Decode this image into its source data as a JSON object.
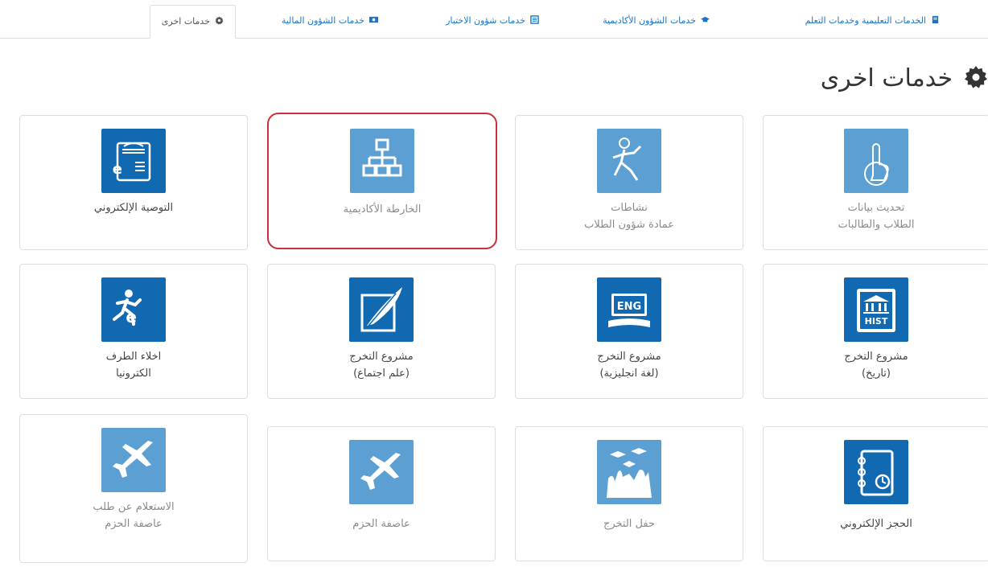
{
  "tabs": [
    {
      "label": "الخدمات التعليمية وخدمات التعلم",
      "icon": "book-icon"
    },
    {
      "label": "خدمات الشؤون الأكاديمية",
      "icon": "graduation-cap-icon"
    },
    {
      "label": "خدمات شؤون الاختبار",
      "icon": "list-icon"
    },
    {
      "label": "خدمات الشؤون المالية",
      "icon": "money-icon"
    },
    {
      "label": "خدمات اخرى",
      "icon": "gear-icon",
      "active": true
    }
  ],
  "page": {
    "title": "خدمات اخرى",
    "icon": "gear-icon"
  },
  "colors": {
    "tile_dark": "#1169b2",
    "tile_light": "#5c9fd3",
    "highlight": "#c9303c",
    "link": "#1a73c9"
  },
  "cards": [
    {
      "id": "update-data",
      "icon": "hand-tap-icon",
      "lines": [
        "تحديث بيانات",
        "الطلاب والطالبات"
      ],
      "faded": true
    },
    {
      "id": "activities",
      "icon": "dancer-icon",
      "lines": [
        "نشاطات",
        "عمادة شؤون الطلاب"
      ],
      "faded": true
    },
    {
      "id": "academic-map",
      "icon": "sitemap-icon",
      "lines": [
        "الخارطة الأكاديمية"
      ],
      "faded": true,
      "highlighted": true
    },
    {
      "id": "e-recommendation",
      "icon": "e-document-icon",
      "lines": [
        "التوصية الإلكتروني"
      ],
      "faded": false
    },
    {
      "id": "grad-history",
      "icon": "hist-book-icon",
      "lines": [
        "مشروع التخرج",
        "(تاريخ)"
      ],
      "faded": false
    },
    {
      "id": "grad-english",
      "icon": "eng-book-icon",
      "lines": [
        "مشروع التخرج",
        "(لغة انجليزية)"
      ],
      "faded": false
    },
    {
      "id": "grad-sociology",
      "icon": "quill-book-icon",
      "lines": [
        "مشروع التخرج",
        "(علم اجتماع)"
      ],
      "faded": false
    },
    {
      "id": "e-clearance",
      "icon": "running-e-icon",
      "lines": [
        "اخلاء الطرف",
        "الكترونيا"
      ],
      "faded": false
    },
    {
      "id": "e-booking",
      "icon": "notebook-icon",
      "lines": [
        "الحجز الإلكتروني"
      ],
      "faded": false
    },
    {
      "id": "graduation-ceremony",
      "icon": "graduation-caps-icon",
      "lines": [
        "حفل التخرج"
      ],
      "faded": true
    },
    {
      "id": "decisive-storm",
      "icon": "fighter-jet-icon",
      "lines": [
        "عاصفة الحزم"
      ],
      "faded": true
    },
    {
      "id": "storm-inquiry",
      "icon": "fighter-jet-icon",
      "lines": [
        "الاستعلام عن طلب",
        "عاصفة الحزم"
      ],
      "faded": true
    }
  ]
}
